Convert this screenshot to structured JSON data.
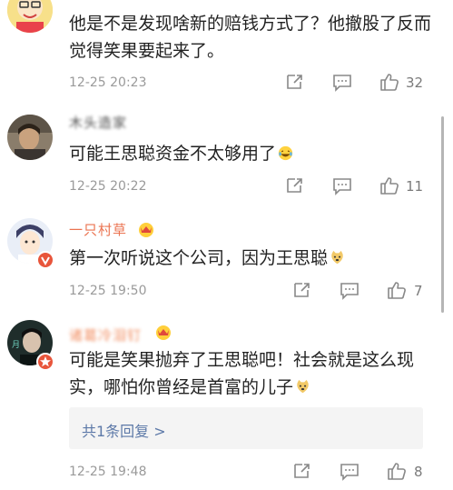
{
  "comments": [
    {
      "username": "",
      "text": "他是不是发现啥新的赔钱方式了？他撤股了反而觉得笑果要起来了。",
      "time": "12-25 20:23",
      "likes": "32",
      "verified": false
    },
    {
      "username": "木头造家",
      "text": "可能王思聪资金不太够用了",
      "emoji": "laughing-tears-emoji",
      "time": "12-25 20:22",
      "likes": "11",
      "verified": false
    },
    {
      "username": "一只村草",
      "text": "第一次听说这个公司，因为王思聪",
      "emoji": "doge-emoji",
      "time": "12-25 19:50",
      "likes": "7",
      "verified": true
    },
    {
      "username": "诸葛冷泪钉",
      "text": "可能是笑果抛弃了王思聪吧！社会就是这么现实，哪怕你曾经是首富的儿子",
      "emoji": "doge-emoji",
      "time": "12-25 19:48",
      "likes": "8",
      "verified": true,
      "reply_link": "共1条回复 >"
    }
  ],
  "icons": {
    "share": "share-icon",
    "comment": "comment-icon",
    "like": "thumbs-up-icon"
  },
  "colors": {
    "username": "#eb7350",
    "reply_link": "#5d79a8",
    "meta": "#9a9a9a",
    "badge": "#e8553b"
  }
}
